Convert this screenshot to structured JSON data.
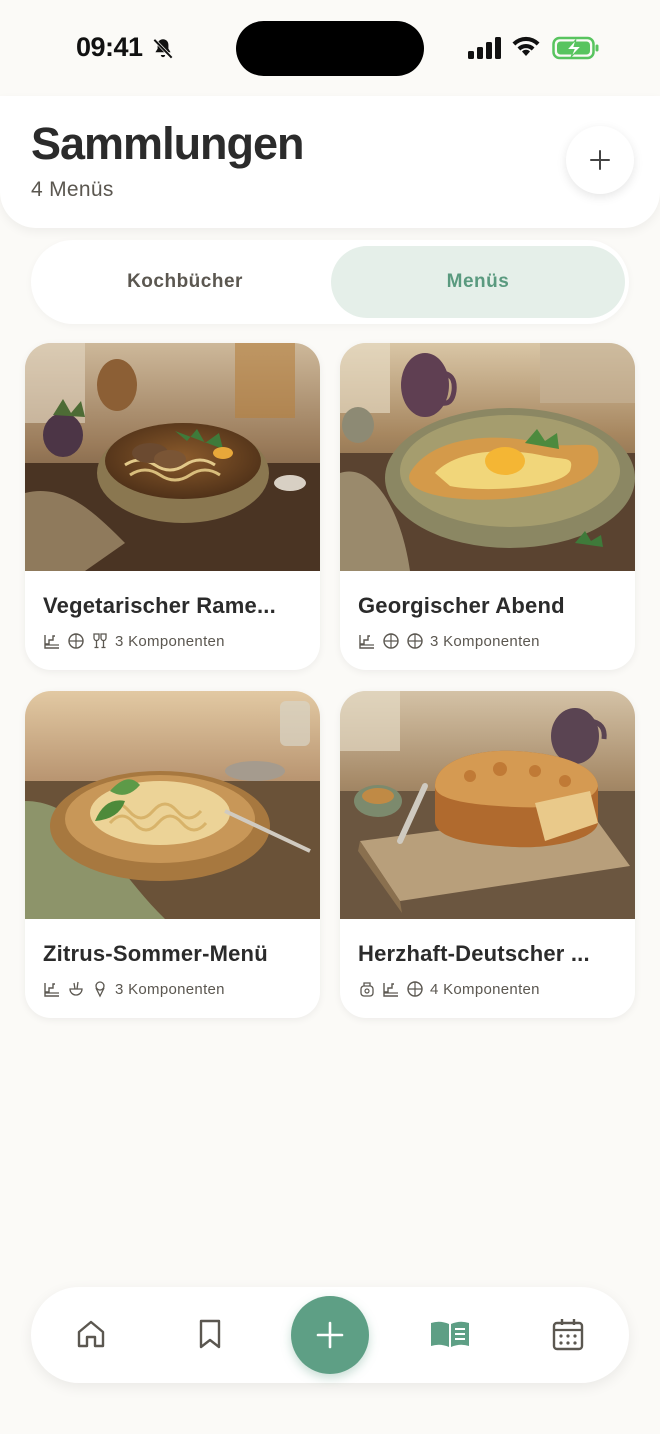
{
  "status_bar": {
    "time": "09:41"
  },
  "header": {
    "title": "Sammlungen",
    "subtitle": "4 Menüs"
  },
  "tabs": [
    {
      "label": "Kochbücher",
      "selected": false
    },
    {
      "label": "Menüs",
      "selected": true
    }
  ],
  "menus": [
    {
      "title": "Vegetarischer Rame...",
      "components": "3 Komponenten",
      "course_icons": [
        "stairs-icon",
        "globe-icon",
        "wine-icon"
      ]
    },
    {
      "title": "Georgischer Abend",
      "components": "3 Komponenten",
      "course_icons": [
        "stairs-icon",
        "globe-icon",
        "globe-icon"
      ]
    },
    {
      "title": "Zitrus-Sommer-Menü",
      "components": "3 Komponenten",
      "course_icons": [
        "stairs-icon",
        "bowl-icon",
        "icecream-icon"
      ]
    },
    {
      "title": "Herzhaft-Deutscher ...",
      "components": "4 Komponenten",
      "course_icons": [
        "toaster-icon",
        "stairs-icon",
        "globe-icon"
      ]
    }
  ],
  "bottom_nav": {
    "items": [
      "home-icon",
      "bookmark-icon",
      "add-icon",
      "book-open-icon",
      "calendar-icon"
    ],
    "active": "book-open-icon"
  },
  "colors": {
    "accent": "#5e9f85",
    "accent_soft": "#e5efe9",
    "background": "#fbfaf7"
  }
}
